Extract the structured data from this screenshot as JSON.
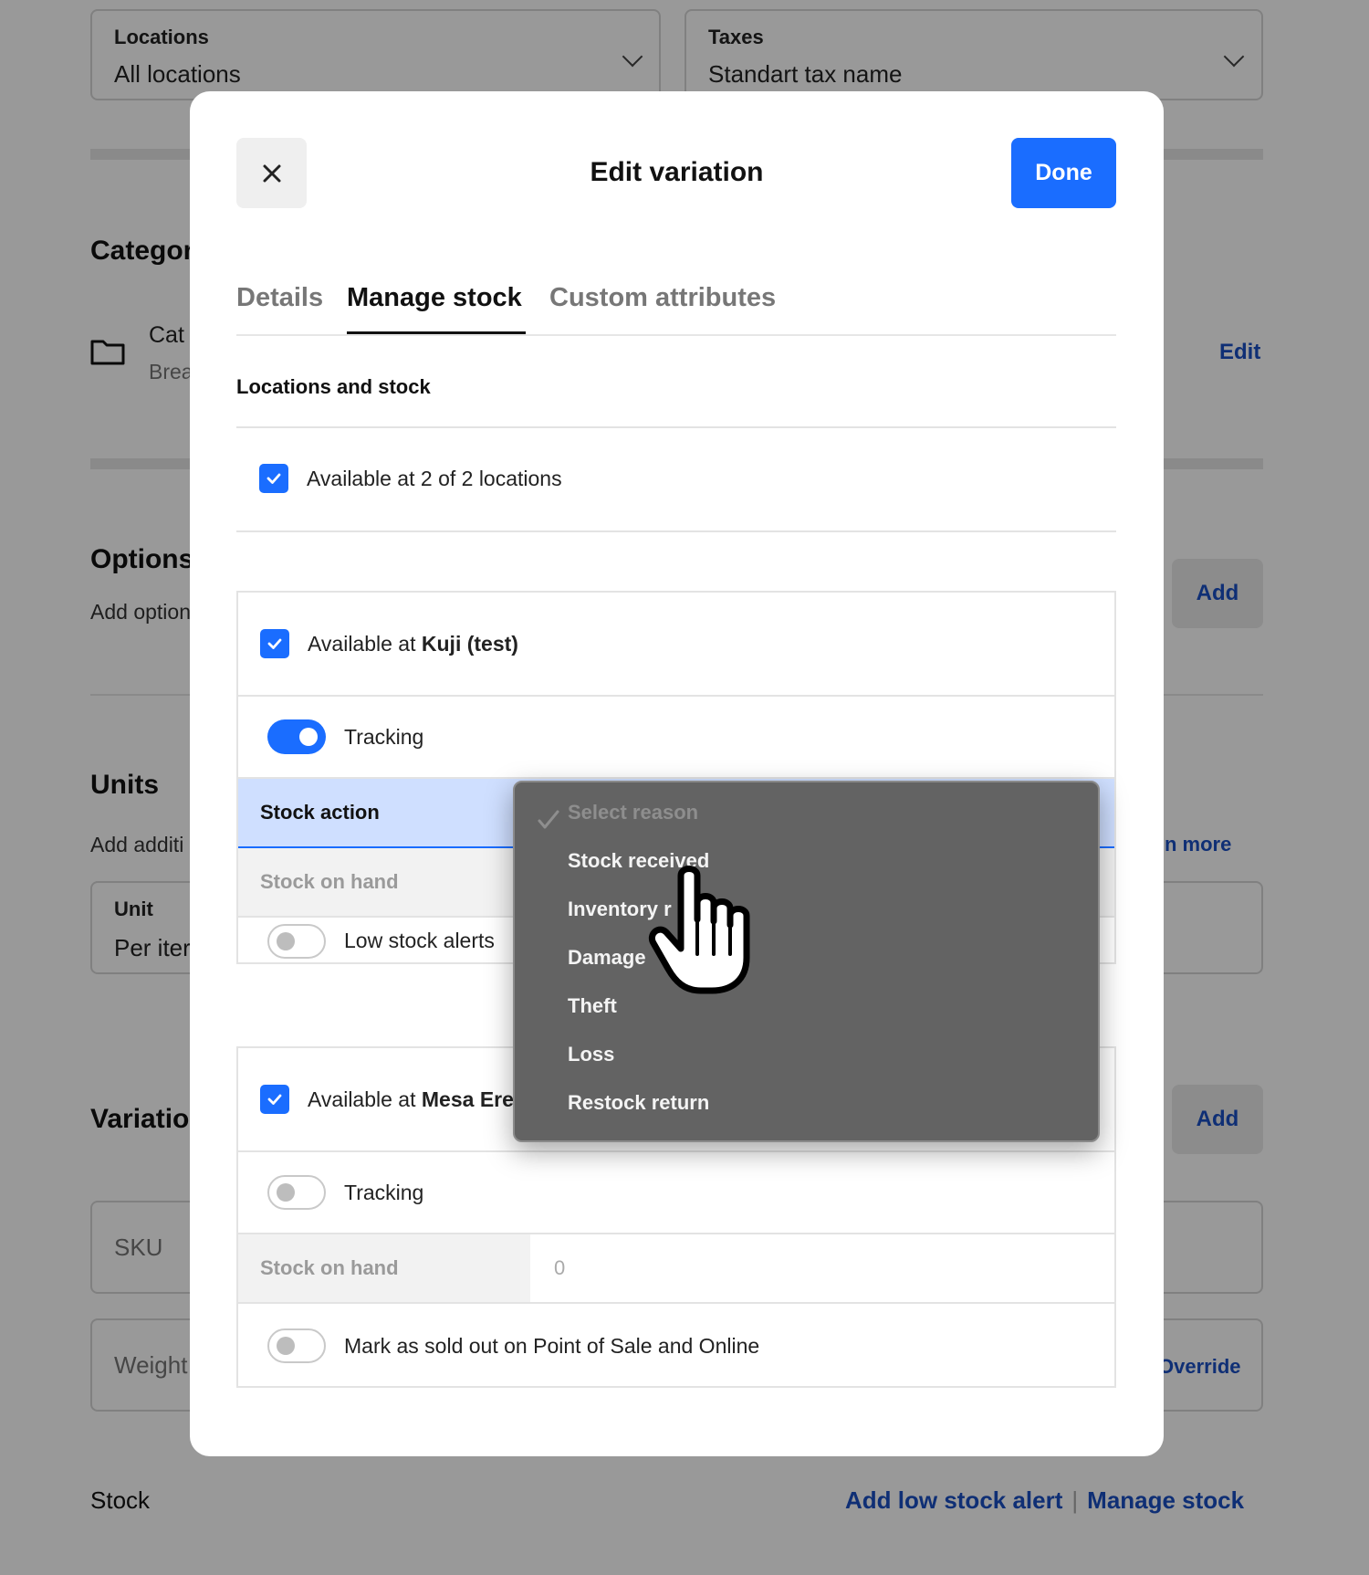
{
  "background": {
    "locations_field": {
      "label": "Locations",
      "value": "All locations"
    },
    "taxes_field": {
      "label": "Taxes",
      "value": "Standart tax name"
    },
    "category_heading": "Categor",
    "category_name": "Cat",
    "category_sub": "Brea",
    "category_edit_link": "Edit",
    "options_heading": "Options",
    "options_sub": "Add option",
    "options_add_button": "Add",
    "units_heading": "Units",
    "units_sub": "Add additi",
    "units_learn_more_link": "n more",
    "unit_field": {
      "label": "Unit",
      "value": "Per iter"
    },
    "variations_heading": "Variatio",
    "variations_add_button": "Add",
    "sku_placeholder": "SKU",
    "weight_placeholder": "Weight",
    "override_link": "Override",
    "stock_heading": "Stock",
    "add_low_stock_alert_link": "Add low stock alert",
    "link_separator": "|",
    "manage_stock_link": "Manage stock"
  },
  "modal": {
    "title": "Edit variation",
    "done_button": "Done",
    "close_icon": "close-icon",
    "tabs": [
      {
        "label": "Details",
        "active": false
      },
      {
        "label": "Manage stock",
        "active": true
      },
      {
        "label": "Custom attributes",
        "active": false
      }
    ],
    "section_title": "Locations and stock",
    "available_all": {
      "prefix": "Available at 2 of 2 locations",
      "checked": true
    },
    "location_1": {
      "available_prefix": "Available at ",
      "name": "Kuji (test)",
      "checked": true,
      "tracking_label": "Tracking",
      "tracking_on": true,
      "stock_action_label": "Stock action",
      "stock_on_hand_label": "Stock on hand",
      "low_stock_alerts_label": "Low stock alerts",
      "low_stock_alerts_on": false
    },
    "location_2": {
      "available_prefix": "Available at ",
      "name": "Mesa Ere",
      "checked": true,
      "tracking_label": "Tracking",
      "tracking_on": false,
      "stock_on_hand_label": "Stock on hand",
      "stock_on_hand_value": "0",
      "sold_out_label": "Mark as sold out on Point of Sale and Online",
      "sold_out_on": false
    }
  },
  "dropdown": {
    "placeholder": "Select reason",
    "options": [
      "Stock received",
      "Inventory r",
      "Damage",
      "Theft",
      "Loss",
      "Restock return"
    ],
    "check_icon": "checkmark-icon"
  },
  "cursor_icon": "hand-pointer-icon",
  "colors": {
    "accent": "#1a6dff",
    "link": "#1a4fc4",
    "stock_action_highlight": "#cfdfff",
    "dropdown_bg": "#636363"
  }
}
